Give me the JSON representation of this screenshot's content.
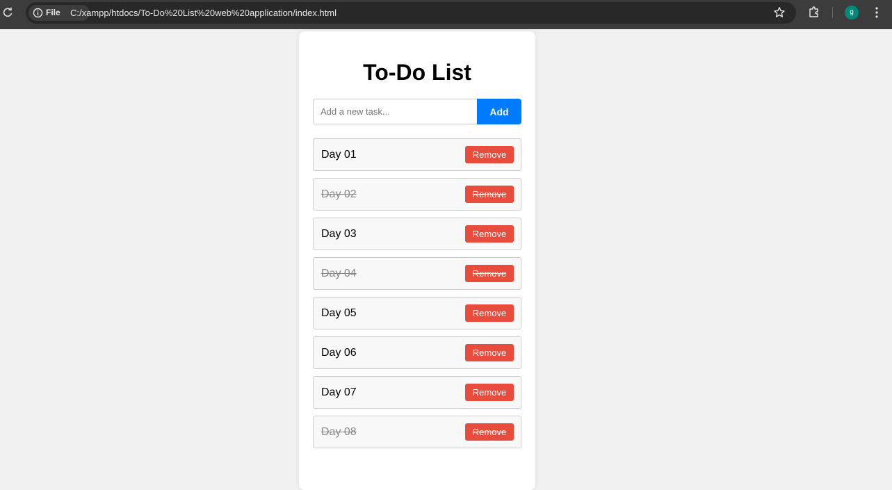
{
  "browser": {
    "site_chip_label": "File",
    "url": "C:/xampp/htdocs/To-Do%20List%20web%20application/index.html",
    "profile_initial": "g",
    "profile_color": "#00897b"
  },
  "app": {
    "title": "To-Do List",
    "input_placeholder": "Add a new task...",
    "input_value": "",
    "add_label": "Add",
    "accent_color": "#007bff",
    "remove_color": "#e74c3c"
  },
  "tasks": [
    {
      "text": "Day 01",
      "completed": false,
      "remove_label": "Remove"
    },
    {
      "text": "Day 02",
      "completed": true,
      "remove_label": "Remove"
    },
    {
      "text": "Day 03",
      "completed": false,
      "remove_label": "Remove"
    },
    {
      "text": "Day 04",
      "completed": true,
      "remove_label": "Remove"
    },
    {
      "text": "Day 05",
      "completed": false,
      "remove_label": "Remove"
    },
    {
      "text": "Day 06",
      "completed": false,
      "remove_label": "Remove"
    },
    {
      "text": "Day 07",
      "completed": false,
      "remove_label": "Remove"
    },
    {
      "text": "Day 08",
      "completed": true,
      "remove_label": "Remove"
    }
  ]
}
